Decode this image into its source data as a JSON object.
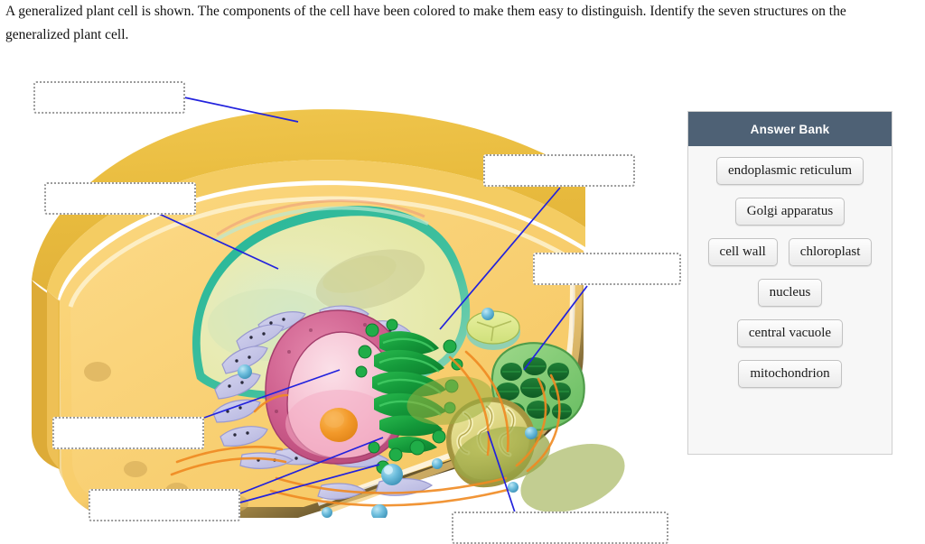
{
  "prompt": {
    "text": "A generalized plant cell is shown. The components of the cell have been colored to make them easy to distinguish. Identify the seven structures on the generalized plant cell."
  },
  "figure": {
    "alt": "generalized-plant-cell-diagram",
    "structure_labels": [
      "cell wall",
      "central vacuole",
      "Golgi apparatus",
      "chloroplast",
      "endoplasmic reticulum",
      "nucleus",
      "mitochondrion"
    ]
  },
  "dropzones": [
    {
      "id": "dropzone-1",
      "value": "",
      "placeholder": ""
    },
    {
      "id": "dropzone-2",
      "value": "",
      "placeholder": ""
    },
    {
      "id": "dropzone-3",
      "value": "",
      "placeholder": ""
    },
    {
      "id": "dropzone-4",
      "value": "",
      "placeholder": ""
    },
    {
      "id": "dropzone-5",
      "value": "",
      "placeholder": ""
    },
    {
      "id": "dropzone-6",
      "value": "",
      "placeholder": ""
    },
    {
      "id": "dropzone-7",
      "value": "",
      "placeholder": ""
    }
  ],
  "answer_bank": {
    "title": "Answer Bank",
    "header_color": "#4e6175",
    "panel_color": "#f7f7f7",
    "rows": [
      {
        "items": [
          {
            "label": "endoplasmic reticulum"
          }
        ]
      },
      {
        "items": [
          {
            "label": "Golgi apparatus"
          }
        ]
      },
      {
        "items": [
          {
            "label": "cell wall"
          },
          {
            "label": "chloroplast"
          }
        ]
      },
      {
        "items": [
          {
            "label": "nucleus"
          }
        ]
      },
      {
        "items": [
          {
            "label": "central vacuole"
          }
        ]
      },
      {
        "items": [
          {
            "label": "mitochondrion"
          }
        ]
      }
    ]
  },
  "colors": {
    "leader_line": "#2222dd",
    "dropzone_border": "#9b9b9b",
    "cell_wall_outer": "#e8b842",
    "cell_wall_mid": "#f2c85a",
    "cytoplasm": "#f8cf72",
    "vacuole": "#e9e7a8",
    "vacuole_edge": "#19b49a",
    "nucleus": "#cf5d8c",
    "nucleolus": "#f09a2a",
    "golgi": "#16a03e",
    "chloroplast": "#1d7a35",
    "mitochondrion": "#d8d37a",
    "er": "#c2c2e8"
  }
}
